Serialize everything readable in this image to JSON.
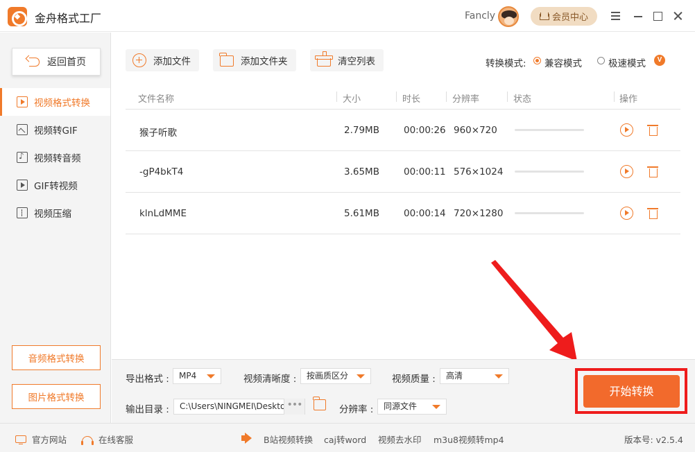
{
  "app": {
    "title": "金舟格式工厂",
    "user": "Fancly",
    "vip_label": "会员中心"
  },
  "sidebar": {
    "back_label": "返回首页",
    "items": [
      {
        "label": "视频格式转换",
        "icon": "video-play-icon",
        "active": true
      },
      {
        "label": "视频转GIF",
        "icon": "image-icon",
        "active": false
      },
      {
        "label": "视频转音频",
        "icon": "music-file-icon",
        "active": false
      },
      {
        "label": "GIF转视频",
        "icon": "play-file-icon",
        "active": false
      },
      {
        "label": "视频压缩",
        "icon": "compress-icon",
        "active": false
      }
    ],
    "audio_btn": "音频格式转换",
    "image_btn": "图片格式转换"
  },
  "toolbar": {
    "add_file": "添加文件",
    "add_folder": "添加文件夹",
    "clear_list": "清空列表",
    "mode_label": "转换模式:",
    "mode_compat": "兼容模式",
    "mode_fast": "极速模式",
    "vip_badge": "V"
  },
  "table": {
    "headers": {
      "name": "文件名称",
      "size": "大小",
      "duration": "时长",
      "resolution": "分辨率",
      "status": "状态",
      "action": "操作"
    },
    "rows": [
      {
        "name": "猴子听歌",
        "size": "2.79MB",
        "duration": "00:00:26",
        "resolution": "960×720",
        "progress": 0
      },
      {
        "name": "-gP4bkT4",
        "size": "3.65MB",
        "duration": "00:00:11",
        "resolution": "576×1024",
        "progress": 0
      },
      {
        "name": "klnLdMME",
        "size": "5.61MB",
        "duration": "00:00:14",
        "resolution": "720×1280",
        "progress": 0
      }
    ]
  },
  "settings": {
    "format_label": "导出格式 :",
    "format_value": "MP4",
    "clarity_label": "视频清晰度 :",
    "clarity_value": "按画质区分",
    "quality_label": "视频质量 :",
    "quality_value": "高清",
    "output_label": "输出目录 :",
    "output_value": "C:\\Users\\NINGMEI\\Deskto",
    "resolution_label": "分辨率 :",
    "resolution_value": "同源文件",
    "start_label": "开始转换",
    "dots": "•••"
  },
  "footer": {
    "website": "官方网站",
    "service": "在线客服",
    "links": [
      "B站视频转换",
      "caj转word",
      "视频去水印",
      "m3u8视频转mp4"
    ],
    "version": "版本号: v2.5.4"
  },
  "colors": {
    "accent": "#f07a2a",
    "start": "#f26a2c",
    "highlight": "#ee1c1c"
  }
}
